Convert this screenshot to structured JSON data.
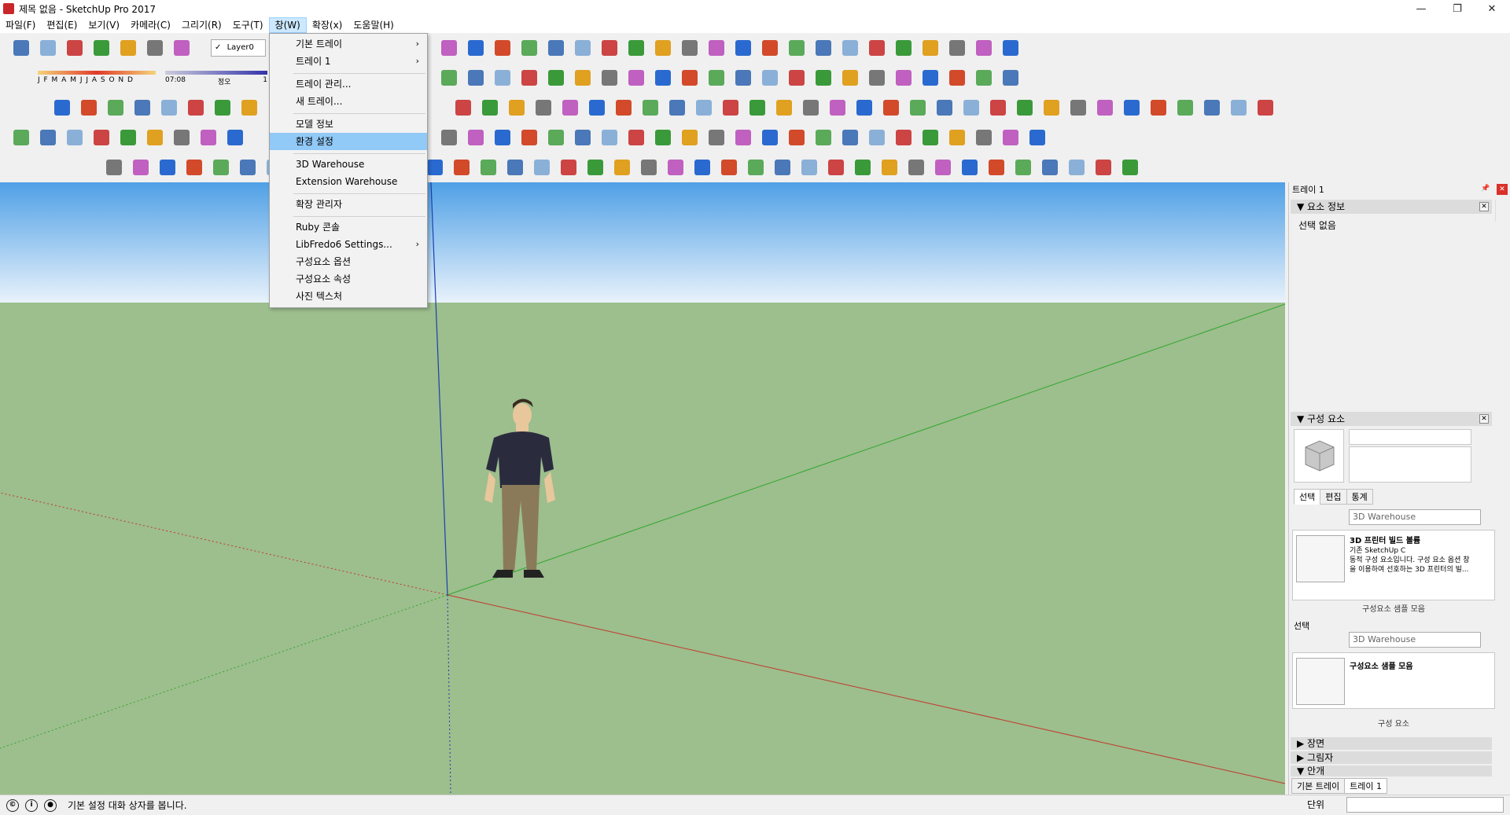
{
  "window": {
    "title": "제목 없음 - SketchUp Pro 2017",
    "controls": [
      "—",
      "❐",
      "✕"
    ]
  },
  "menubar": {
    "items": [
      "파일(F)",
      "편집(E)",
      "보기(V)",
      "카메라(C)",
      "그리기(R)",
      "도구(T)",
      "창(W)",
      "확장(x)",
      "도움말(H)"
    ],
    "active_index": 6
  },
  "window_menu": {
    "items": [
      {
        "label": "기본 트레이",
        "submenu": true
      },
      {
        "label": "트레이 1",
        "submenu": true
      },
      {
        "label": "트레이 관리...",
        "submenu": false
      },
      {
        "label": "새 트레이...",
        "submenu": false
      },
      {
        "label": "모델 정보",
        "submenu": false
      },
      {
        "label": "환경 설정",
        "submenu": false,
        "highlighted": true
      },
      {
        "label": "3D Warehouse",
        "submenu": false
      },
      {
        "label": "Extension Warehouse",
        "submenu": false
      },
      {
        "label": "확장 관리자",
        "submenu": false
      },
      {
        "label": "Ruby 콘솔",
        "submenu": false
      },
      {
        "label": "LibFredo6 Settings...",
        "submenu": true
      },
      {
        "label": "구성요소 옵션",
        "submenu": false
      },
      {
        "label": "구성요소 속성",
        "submenu": false
      },
      {
        "label": "사진 텍스처",
        "submenu": false
      }
    ],
    "submenu_arrow": "›"
  },
  "toolbar": {
    "layer_check": "✓",
    "layer_name": "Layer0",
    "shadow_months": "J F M A M J J A S O N D",
    "shadow_time": "07:08",
    "shadow_noon": "정오",
    "shadow_end": "1"
  },
  "tray": {
    "title": "트레이 1",
    "pin": "📌",
    "close": "✕",
    "entity_info": {
      "header": "▼ 요소 정보",
      "selection": "선택 없음"
    },
    "components": {
      "header": "▼ 구성 요소",
      "tabs": [
        "선택",
        "편집",
        "통계"
      ],
      "search_placeholder": "3D Warehouse",
      "item_title": "3D 프린터 빌드 볼륨",
      "item_line1": "기존 SketchUp C",
      "item_line2": "동적 구성 요소입니다. 구성 요소 옵션 창",
      "item_line3": "을 이용하여 선호하는 3D 프린터의 빌...",
      "nav_label": "구성요소 샘플 모음",
      "second_label": "선택",
      "second_search": "3D Warehouse",
      "second_item": "구성요소 샘플 모음",
      "second_nav": "구성 요소"
    },
    "collapsed": [
      "▶ 장면",
      "▶ 그림자",
      "▼ 안개"
    ],
    "bottom_tabs": [
      "기본 트레이",
      "트레이 1"
    ]
  },
  "statusbar": {
    "message": "기본 설정 대화 상자를 봅니다.",
    "unit_label": "단위"
  },
  "colors": {
    "sky_top": "#4fa0e6",
    "ground": "#9dbe8d",
    "menu_highlight": "#91c9f7",
    "axis_red": "#c0392b",
    "axis_green": "#2ea82e",
    "axis_blue": "#1a3fb0"
  }
}
